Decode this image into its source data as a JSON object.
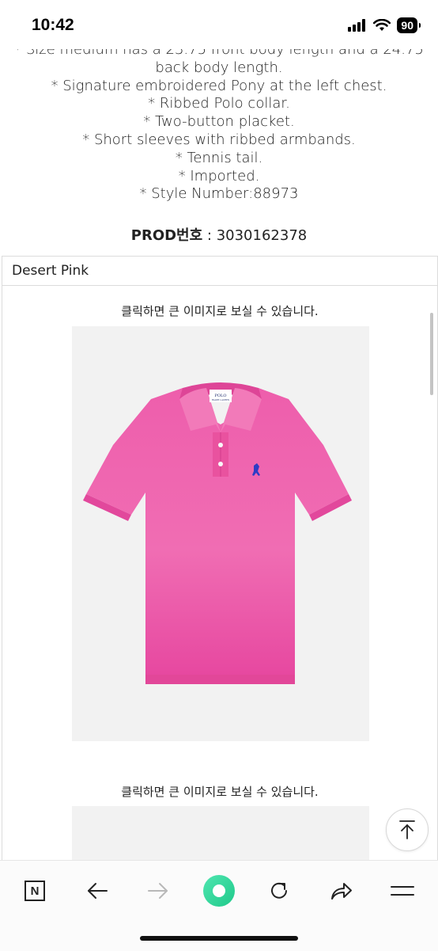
{
  "status_bar": {
    "time": "10:42",
    "battery": "90"
  },
  "description": {
    "lines": [
      "* Size medium has a 23.75 front body length and a 24.75",
      "back body length.",
      "* Signature embroidered Pony at the left chest.",
      "* Ribbed Polo collar.",
      "* Two-button placket.",
      "* Short sleeves with ribbed armbands.",
      "* Tennis tail.",
      "* Imported.",
      "* Style Number:88973"
    ],
    "prod_label": "PROD번호",
    "prod_separator": " : ",
    "prod_value": "3030162378"
  },
  "color_section": {
    "color_name": "Desert Pink",
    "click_caption_1": "클릭하면 큰 이미지로 보실 수 있습니다.",
    "click_caption_2": "클릭하면 큰 이미지로 보실 수 있습니다.",
    "shirt_color": "#ef5fae",
    "collar_label_top": "POLO",
    "collar_label_bottom": "RALPH LAUREN",
    "logo_color": "#2f3cc4"
  },
  "icons": {
    "scroll_top": "arrow-up-to-top-icon",
    "naver": "naver-n-icon",
    "back": "arrow-left-icon",
    "forward": "arrow-right-icon",
    "home": "green-circle-icon",
    "reload": "reload-icon",
    "share": "share-icon",
    "menu": "hamburger-menu-icon"
  },
  "browser_bar": {
    "naver_letter": "N"
  }
}
